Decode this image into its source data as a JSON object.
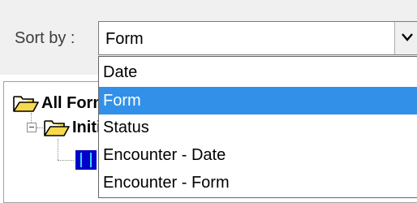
{
  "sort": {
    "label": "Sort by :",
    "current_value": "Form",
    "options": [
      {
        "label": "Date",
        "selected": false
      },
      {
        "label": "Form",
        "selected": true
      },
      {
        "label": "Status",
        "selected": false
      },
      {
        "label": "Encounter - Date",
        "selected": false
      },
      {
        "label": "Encounter - Form",
        "selected": false
      }
    ]
  },
  "tree": {
    "root_label": "All Forms",
    "child_label": "Initial"
  },
  "colors": {
    "selection": "#3390e8",
    "panel": "#f0f0f0",
    "folder_fill": "#f7d94c",
    "form_icon": "#0000c8"
  },
  "icons": {
    "dropdown": "chevron-down-icon",
    "folder": "open-folder-icon",
    "form": "form-icon"
  }
}
